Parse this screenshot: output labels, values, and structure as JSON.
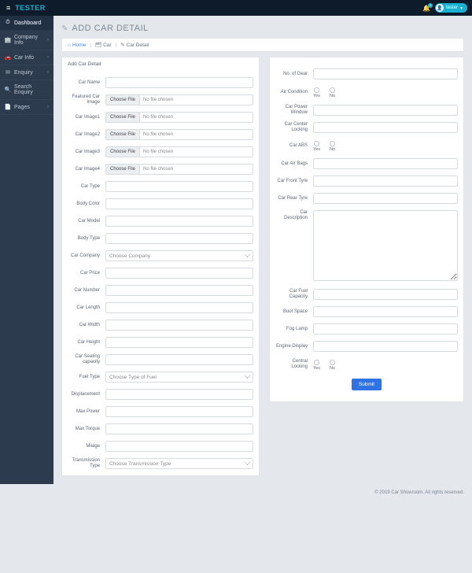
{
  "brand": "TESTER",
  "topbar": {
    "bell_badge": "0",
    "user_name": "tester",
    "caret": "▾"
  },
  "sidebar": {
    "items": [
      {
        "icon": "⏱",
        "label": "Dashboard",
        "expandable": false
      },
      {
        "icon": "🏢",
        "label": "Company Info",
        "expandable": true
      },
      {
        "icon": "🚗",
        "label": "Car Info",
        "expandable": true
      },
      {
        "icon": "✉",
        "label": "Enquiry",
        "expandable": true
      },
      {
        "icon": "🔍",
        "label": "Search Enquiry",
        "expandable": false
      },
      {
        "icon": "📄",
        "label": "Pages",
        "expandable": true
      }
    ]
  },
  "page": {
    "title": "ADD CAR DETAIL"
  },
  "breadcrumb": {
    "home_icon": "⌂",
    "home": "Home",
    "car_icon": "🗂",
    "car": "Car",
    "detail_icon": "✎",
    "detail": "Car Detail"
  },
  "left": {
    "card_title": "Add Car Detail",
    "labels": {
      "car_name": "Car Name",
      "featured": "Featured Car Image",
      "img1": "Car Image1",
      "img2": "Car Image2",
      "img3": "Car Image3",
      "img4": "Car Image4",
      "car_type": "Car Type",
      "body_color": "Body Color",
      "car_model": "Car Model",
      "body_type": "Body Type",
      "company": "Car Company",
      "price": "Car Price",
      "number": "Car Number",
      "length": "Car Length",
      "width": "Car Width",
      "height": "Car Height",
      "seating": "Car Seating capacity",
      "fuel_type": "Fuel Type",
      "displacement": "Displacement",
      "max_power": "Max Power",
      "max_torque": "Max Torque",
      "milage": "Milage",
      "transmission": "Transmission Type"
    },
    "file": {
      "choose": "Choose File",
      "none": "No file chosen"
    },
    "select": {
      "company": "Choose Company",
      "fuel": "Choose Type of Fuel",
      "transmission": "Choose Transmission Type"
    }
  },
  "right": {
    "labels": {
      "no_of_gear": "No. of Gear",
      "air_condition": "Air Condition",
      "power_window": "Car Power Window",
      "center_locking": "Car Center Locking",
      "abs": "Car ABS",
      "air_bags": "Car Air Bags",
      "front_tyre": "Car Front Tyre",
      "rear_tyre": "Car Rear Tyre",
      "description": "Car Description",
      "fuel_capacity": "Car Fuel Capacity",
      "boot_space": "Boot Space",
      "fog_lamp": "Fog Lamp",
      "engine_display": "Engine Display",
      "central_locking": "Central Locking"
    },
    "radio": {
      "yes": "Yes",
      "no": "No"
    },
    "submit": "Submit"
  },
  "footer": "© 2019 Car Showroom. All rights reserved."
}
